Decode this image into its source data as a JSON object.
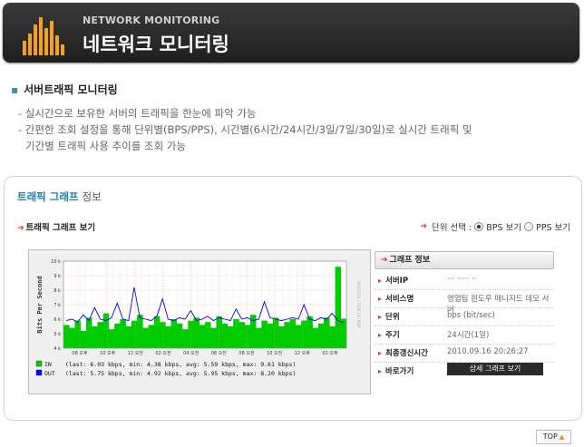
{
  "header": {
    "subtitle": "NETWORK MONITORING",
    "title": "네트워크 모니터링"
  },
  "section": {
    "title": "서버트래픽 모니터링",
    "lines": [
      "- 실시간으로 보유한 서버의 트래픽을 한눈에 파악 가능",
      "- 간편한 조회 설정을 통해 단위별(BPS/PPS), 시간별(6시간/24시간/3일/7일/30일)로 실시간 트래픽 및",
      "기간별 트래픽 사용 추이를 조회 가능"
    ]
  },
  "panel": {
    "title_a": "트래픽 그래프",
    "title_b": "정보",
    "graph_label": "트래픽 그래프 보기",
    "unit_label": "단위 선택 :",
    "unit_options": [
      "BPS 보기",
      "PPS 보기"
    ],
    "unit_selected": "BPS 보기"
  },
  "chart_data": {
    "type": "area",
    "ylabel": "Bits Per Second",
    "ytick_labels": [
      "10 k",
      "9 k",
      "8 k",
      "7 k",
      "6 k",
      "5 k",
      "4 k"
    ],
    "ylim": [
      4,
      10
    ],
    "xtick_labels": [
      "08 오후",
      "10 오후",
      "12 오전",
      "02 오전",
      "04 오전",
      "06 오전",
      "08 오전",
      "10 오전",
      "12 오후",
      "02 오후"
    ],
    "right_axis_label": "RRDTOOL / TOBI OETIKER",
    "grid": true,
    "colors": {
      "in": "#00cc00",
      "out": "#0000ff",
      "grid_major": "#ff9999"
    },
    "series": [
      {
        "name": "IN",
        "stats": "(last:    6.03 kbps, min:    4.38 kbps, avg:    5.59 kbps, max:    9.61 kbps)",
        "values": [
          5.6,
          5.4,
          5.9,
          5.2,
          6.1,
          5.5,
          5.8,
          6.4,
          5.3,
          5.7,
          6.0,
          5.5,
          5.9,
          6.3,
          5.4,
          5.6,
          6.2,
          5.8,
          5.5,
          6.0,
          5.7,
          5.3,
          5.9,
          6.1,
          5.6,
          5.8,
          5.4,
          6.2,
          5.7,
          5.5,
          6.0,
          5.8,
          5.6,
          6.3,
          5.4,
          5.9,
          5.7,
          6.1,
          5.5,
          5.8,
          6.0,
          5.6,
          5.9,
          6.2,
          5.4,
          5.7,
          6.1,
          5.5,
          9.61,
          6.03
        ]
      },
      {
        "name": "OUT",
        "stats": "(last:    5.75 kbps, min:    4.92 kbps, avg:    5.95 kbps, max:    8.20 kbps)",
        "values": [
          5.9,
          6.0,
          5.8,
          6.3,
          5.9,
          6.8,
          6.0,
          5.9,
          6.1,
          7.1,
          6.0,
          5.9,
          8.2,
          6.1,
          6.0,
          5.9,
          6.2,
          7.4,
          6.0,
          5.9,
          6.1,
          6.0,
          6.6,
          5.9,
          6.0,
          6.2,
          5.9,
          6.1,
          6.0,
          5.9,
          6.7,
          6.0,
          6.1,
          5.9,
          6.0,
          7.2,
          6.1,
          6.0,
          5.9,
          6.0,
          6.1,
          6.0,
          7.0,
          6.0,
          5.9,
          6.1,
          6.0,
          6.4,
          5.9,
          5.75
        ]
      }
    ]
  },
  "info": {
    "head": "그래프 정보",
    "rows": [
      {
        "k": "서버IP",
        "v": "··· ····· ··"
      },
      {
        "k": "서비스명",
        "v": "영업팀 윈도우 매니지드 데모 서버"
      },
      {
        "k": "단위",
        "v": "bps (bit/sec)"
      },
      {
        "k": "주기",
        "v": "24시간(1일)"
      },
      {
        "k": "최종갱신시간",
        "v": "2010.09.16 20:26:27"
      },
      {
        "k": "바로가기",
        "v": ""
      }
    ],
    "detail_button": "상세 그래프 보기"
  },
  "top_button": "TOP"
}
